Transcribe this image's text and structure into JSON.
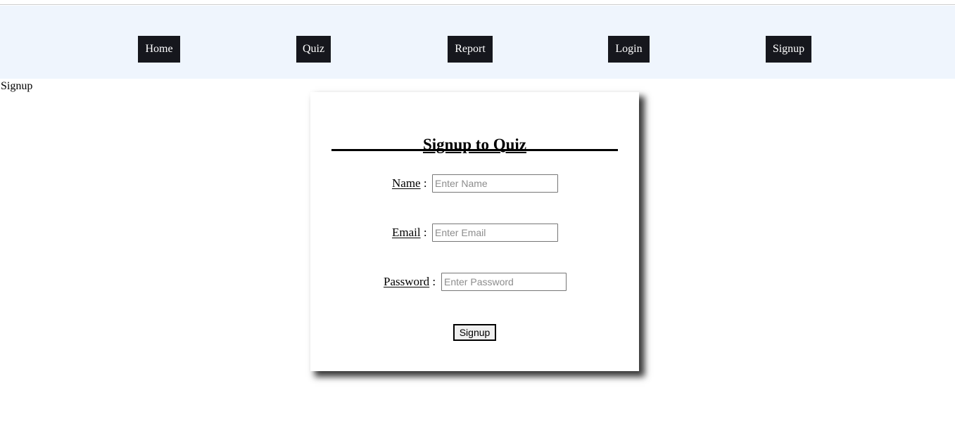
{
  "page": {
    "label": "Signup",
    "background_color": "#ffffff"
  },
  "navbar": {
    "background_color": "#eff5fd",
    "item_background_color": "#16171d",
    "item_text_color": "#ffffff",
    "items": [
      {
        "label": "Home",
        "name": "nav-item-home"
      },
      {
        "label": "Quiz",
        "name": "nav-item-quiz"
      },
      {
        "label": "Report",
        "name": "nav-item-report"
      },
      {
        "label": "Login",
        "name": "nav-item-login"
      },
      {
        "label": "Signup",
        "name": "nav-item-signup"
      }
    ]
  },
  "card": {
    "title": "Signup to Quiz",
    "fields": [
      {
        "label": "Name",
        "separator": " :",
        "placeholder": "Enter Name",
        "value": ""
      },
      {
        "label": "Email",
        "separator": " :",
        "placeholder": "Enter Email",
        "value": ""
      },
      {
        "label": "Password",
        "separator": " :",
        "placeholder": "Enter Password",
        "value": ""
      }
    ],
    "submit_label": "Signup"
  }
}
